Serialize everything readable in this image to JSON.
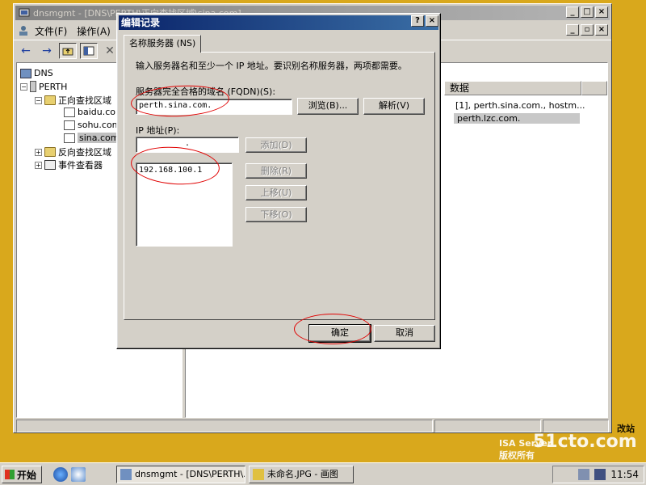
{
  "main_window": {
    "title": "dnsmgmt - [DNS\\PERTH\\正向查找区域\\sina.com]",
    "menu": [
      "文件(F)",
      "操作(A)"
    ],
    "tree": {
      "root": "DNS",
      "server": "PERTH",
      "forward_zone": "正向查找区域",
      "zones": [
        "baidu.com",
        "sohu.com",
        "sina.com"
      ],
      "reverse_zone": "反向查找区域",
      "event_viewer": "事件查看器"
    },
    "column_data_header": "数据",
    "rows": [
      "[1], perth.sina.com., hostm...",
      "perth.lzc.com."
    ]
  },
  "dialog": {
    "title": "编辑记录",
    "tab_label": "名称服务器 (NS)",
    "instruction": "输入服务器名和至少一个 IP 地址。要识别名称服务器，两项都需要。",
    "fqdn_label": "服务器完全合格的域名 (FQDN)(S):",
    "fqdn_value": "perth.sina.com.",
    "browse_button": "浏览(B)...",
    "resolve_button": "解析(V)",
    "ip_label": "IP 地址(P):",
    "ip_input_value": ".",
    "add_button": "添加(D)",
    "remove_button": "删除(R)",
    "up_button": "上移(U)",
    "down_button": "下移(O)",
    "ip_list": [
      "192.168.100.1"
    ],
    "ok_button": "确定",
    "cancel_button": "取消"
  },
  "taskbar": {
    "start_label": "开始",
    "tasks": [
      "dnsmgmt - [DNS\\PERTH\\...",
      "未命名.JPG - 画图"
    ],
    "clock": "11:54"
  },
  "watermark": {
    "brand": "51cto.com",
    "isa": "ISA Server",
    "rights": "版权所有",
    "partial": "改站"
  },
  "colors": {
    "desktop": "#d9a81c",
    "dialog_title": "#0a246a",
    "annotation": "#e00000"
  }
}
